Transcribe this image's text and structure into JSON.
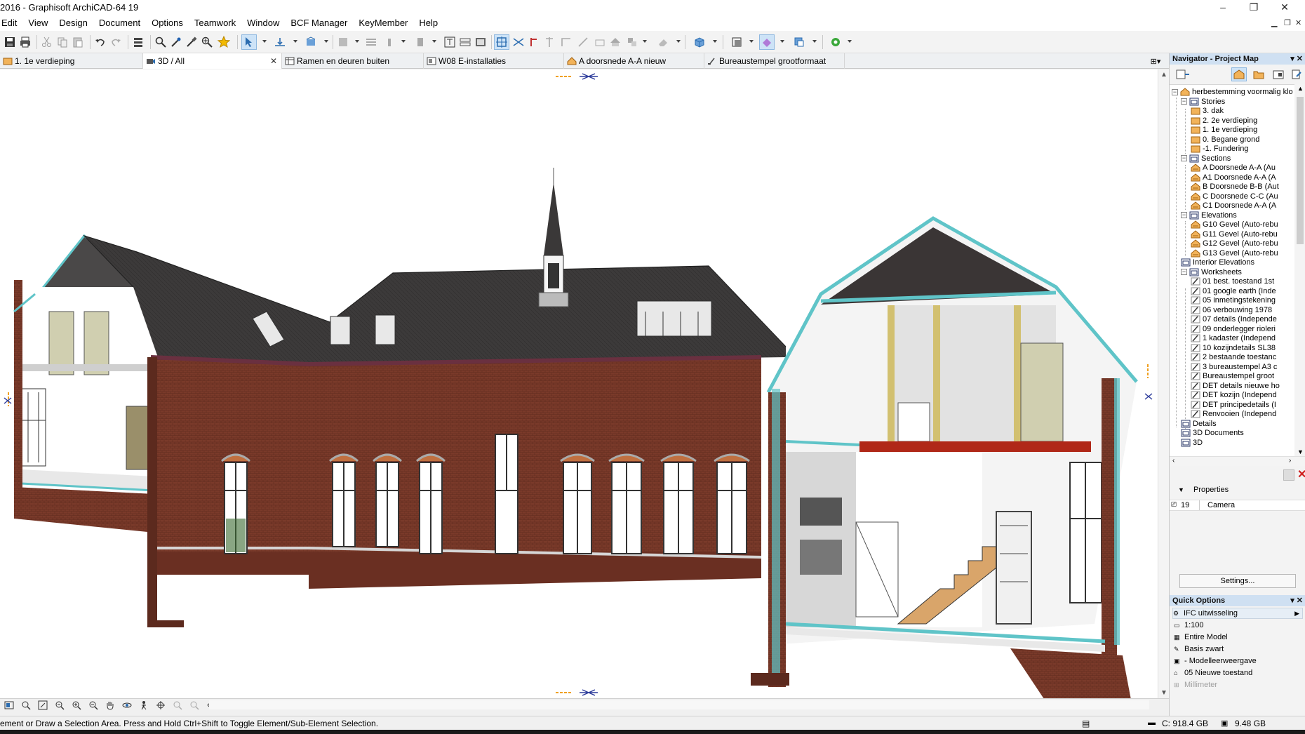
{
  "window": {
    "title": "2016 - Graphisoft ArchiCAD-64 19",
    "minimize": "–",
    "restore": "❐",
    "close": "✕"
  },
  "menu": [
    "Edit",
    "View",
    "Design",
    "Document",
    "Options",
    "Teamwork",
    "Window",
    "BCF Manager",
    "KeyMember",
    "Help"
  ],
  "tabs": [
    {
      "label": "1. 1e verdieping"
    },
    {
      "label": "3D / All"
    },
    {
      "label": "Ramen en deuren buiten"
    },
    {
      "label": "W08 E-installaties"
    },
    {
      "label": "A doorsnede A-A  nieuw"
    },
    {
      "label": "Bureaustempel grootformaat"
    }
  ],
  "navigator": {
    "title": "Navigator - Project Map",
    "tree": [
      {
        "label": "herbestemming voormalig klo"
      },
      {
        "label": "Stories"
      },
      {
        "label": "3. dak"
      },
      {
        "label": "2. 2e verdieping"
      },
      {
        "label": "1. 1e verdieping"
      },
      {
        "label": "0. Begane grond"
      },
      {
        "label": "-1. Fundering"
      },
      {
        "label": "Sections"
      },
      {
        "label": "A Doorsnede A-A (Au"
      },
      {
        "label": "A1 Doorsnede A-A (A"
      },
      {
        "label": "B Doorsnede B-B (Aut"
      },
      {
        "label": "C Doorsnede C-C (Au"
      },
      {
        "label": "C1 Doorsnede A-A (A"
      },
      {
        "label": "Elevations"
      },
      {
        "label": "G10 Gevel (Auto-rebu"
      },
      {
        "label": "G11 Gevel (Auto-rebu"
      },
      {
        "label": "G12 Gevel (Auto-rebu"
      },
      {
        "label": "G13 Gevel (Auto-rebu"
      },
      {
        "label": "Interior Elevations"
      },
      {
        "label": "Worksheets"
      },
      {
        "label": "01 best. toestand 1st"
      },
      {
        "label": "01 google earth (Inde"
      },
      {
        "label": "05 inmetingstekening"
      },
      {
        "label": "06 verbouwing 1978"
      },
      {
        "label": "07 details (Independe"
      },
      {
        "label": "09 onderlegger rioleri"
      },
      {
        "label": "1 kadaster (Independ"
      },
      {
        "label": "10 kozijndetails SL38"
      },
      {
        "label": "2 bestaande toestanc"
      },
      {
        "label": "3 bureaustempel A3 c"
      },
      {
        "label": "Bureaustempel groot"
      },
      {
        "label": "DET details nieuwe ho"
      },
      {
        "label": "DET kozijn (Independ"
      },
      {
        "label": "DET principedetails (I"
      },
      {
        "label": "Renvooien (Independ"
      },
      {
        "label": "Details"
      },
      {
        "label": "3D Documents"
      },
      {
        "label": "3D"
      }
    ]
  },
  "properties": {
    "header": "Properties",
    "id": "19",
    "type": "Camera",
    "settings_label": "Settings..."
  },
  "quick_options": {
    "title": "Quick Options",
    "items": [
      {
        "label": "IFC uitwisseling"
      },
      {
        "label": "1:100"
      },
      {
        "label": "Entire Model"
      },
      {
        "label": "Basis zwart"
      },
      {
        "label": "- Modelleerweergave"
      },
      {
        "label": "05 Nieuwe toestand"
      },
      {
        "label": "Millimeter"
      }
    ]
  },
  "status": {
    "message": "ement or Draw a Selection Area. Press and Hold Ctrl+Shift to Toggle Element/Sub-Element Selection.",
    "disk_c": "C: 918.4 GB",
    "memory": "9.48 GB"
  },
  "colors": {
    "accent_selected": "#cde3f7",
    "panel_header": "#cfe0f2",
    "brick": "#7a3a2a",
    "roof": "#3a3838",
    "cut_line": "#5fc4c8"
  }
}
